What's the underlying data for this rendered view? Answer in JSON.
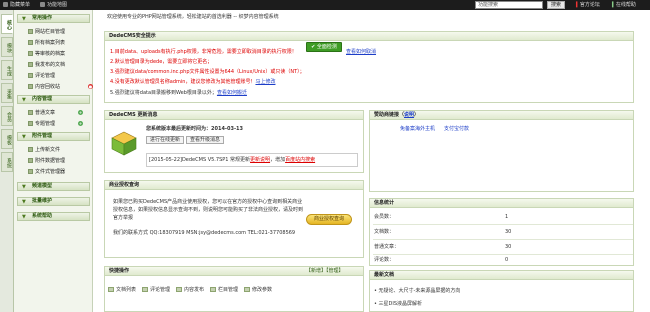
{
  "topbar": {
    "hide_menu": "隐藏菜单",
    "function_map": "功能地图",
    "search_placeholder": "功能搜索",
    "search_button": "搜索",
    "official_forum": "官方论坛",
    "online_help": "在线帮助"
  },
  "vtabs": [
    "核心",
    "模块",
    "生成",
    "采集",
    "会员",
    "模板",
    "系统"
  ],
  "menu": {
    "groups": [
      {
        "title": "常用操作",
        "items": [
          "网站栏目管理",
          "所有档案列表",
          "等审核的档案",
          "我发布的文档",
          "评论管理",
          "内容回收站"
        ]
      },
      {
        "title": "内容管理",
        "items": [
          "普通文章",
          "专题管理"
        ]
      },
      {
        "title": "附件管理",
        "items": [
          "上传新文件",
          "附件数据管理",
          "文件式管理器"
        ]
      },
      {
        "title": "频道模型"
      },
      {
        "title": "批量维护"
      },
      {
        "title": "系统帮助"
      }
    ]
  },
  "welcome": "欢迎使用专业的PHP网站管理系统，轻松建站的首选利器 -- 织梦内容管理系统",
  "security": {
    "title": "DedeCMS安全提示",
    "line1": "1.目前data、uploads有执行.php权限，非常危险，需要立即取消目录的执行权限！",
    "check_button": "全面检测",
    "check_link": "查看如何取消",
    "line2": "2.默认管理目录为dede，需要立即将它更名；",
    "line3": "3.强烈建议data/common.inc.php文件属性设置为644（Linux/Unix）或只读（NT）；",
    "line4_a": "4.没有更改默认管理员名称admin，建议您修改为其他管理账号！",
    "line4_link": "马上修改",
    "line5_a": "5.强烈建议将data目录搬移到Web根目录以外；",
    "line5_link": "查看如何搬迁"
  },
  "update": {
    "title": "DedeCMS 更新消息",
    "last_update": "您系统版本最后更新时间为：2014-03-13",
    "online_update": "进行在线更新",
    "view_notice": "查看升级消息",
    "log": "[2015-05-22]DedeCMS V5.7SP1 常规更新",
    "log_link": "更新说明",
    "log_tail": "，增加",
    "log_link2": "百度站内搜索"
  },
  "license": {
    "title": "商业授权查询",
    "p1": "如果您已购买DedeCMS产品商业使用授权，您可以在官方的授权中心查询到相关商业授权信息，如果授权信息显示查询不到，则说明您可能购买了非法商业授权，请及时到官方举报",
    "p2": "我们的联系方式 QQ:18307919 MSN:jsy@dedecms.com TEL:021-37708569",
    "button": "商业授权查询"
  },
  "quick": {
    "title": "快捷操作",
    "actions": "【新增】【管理】",
    "items": [
      "文档列表",
      "评论管理",
      "内容发布",
      "栏目管理",
      "修改参数"
    ]
  },
  "sponsor": {
    "title": "赞助商链接（",
    "title_link": "说明",
    "title_end": "）",
    "links": [
      "免备案海外主机",
      "支付宝付款"
    ]
  },
  "stats": {
    "title": "信息统计",
    "rows": [
      {
        "label": "会员数：",
        "value": "1"
      },
      {
        "label": "文档数：",
        "value": "30"
      },
      {
        "label": "普通文章：",
        "value": "30"
      },
      {
        "label": "评论数：",
        "value": "0"
      }
    ]
  },
  "latest": {
    "title": "最新文档",
    "items": [
      "无疑论、大尺寸-未来源晶屏据的方向",
      "三星DIS液晶屏解析"
    ]
  }
}
